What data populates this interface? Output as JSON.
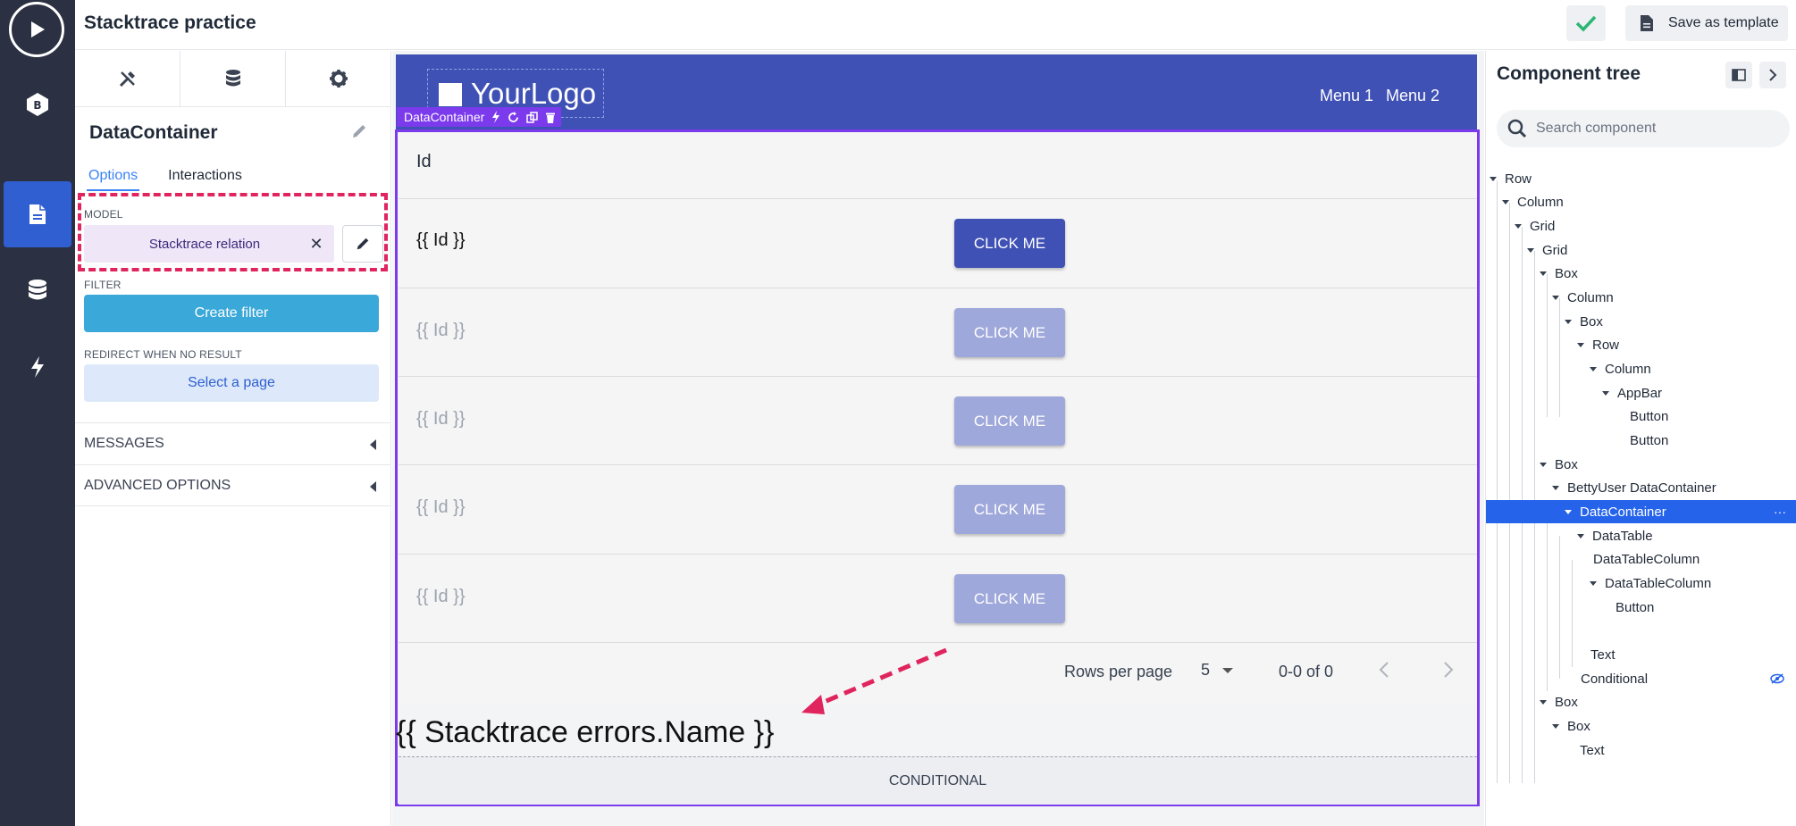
{
  "topbar": {
    "title": "Stacktrace practice",
    "save_label": "Save as template",
    "accent": "#2bb673"
  },
  "side": {
    "component_name": "DataContainer",
    "tab_options": "Options",
    "tab_interactions": "Interactions",
    "model_label": "MODEL",
    "model_value": "Stacktrace relation",
    "model_clear": "✕",
    "filter_label": "FILTER",
    "create_filter": "Create filter",
    "redirect_label": "REDIRECT WHEN NO RESULT",
    "select_page": "Select a page",
    "messages": "MESSAGES",
    "advanced": "ADVANCED OPTIONS"
  },
  "canvas": {
    "logo_light": "Your",
    "logo_bold": "Logo",
    "menu1": "Menu 1",
    "menu2": "Menu 2",
    "badge": "DataContainer",
    "header_col": "Id",
    "rows": [
      {
        "id": "{{ Id }}",
        "button": "CLICK ME"
      },
      {
        "id": "{{ Id }}",
        "button": "CLICK ME"
      },
      {
        "id": "{{ Id }}",
        "button": "CLICK ME"
      },
      {
        "id": "{{ Id }}",
        "button": "CLICK ME"
      },
      {
        "id": "{{ Id }}",
        "button": "CLICK ME"
      }
    ],
    "rows_per_page_label": "Rows per page",
    "rows_per_page_value": "5",
    "range": "0-0 of 0",
    "stacktrace_text": "{{ Stacktrace errors.Name }}",
    "conditional": "CONDITIONAL"
  },
  "tree": {
    "title": "Component tree",
    "search_placeholder": "Search component",
    "nodes": [
      "Row",
      "Column",
      "Grid",
      "Grid",
      "Box",
      "Column",
      "Box",
      "Row",
      "Column",
      "AppBar",
      "Button",
      "Button",
      "Box",
      "BettyUser DataContainer",
      "DataContainer",
      "DataTable",
      "DataTableColumn",
      "DataTableColumn",
      "Button",
      "Text",
      "Conditional",
      "Box",
      "Box",
      "Text"
    ],
    "selected_more": "···"
  },
  "colors": {
    "primary": "#3f51b5",
    "selection": "#7c3aed",
    "highlight": "#e0245e",
    "tree_selected": "#2563eb"
  }
}
